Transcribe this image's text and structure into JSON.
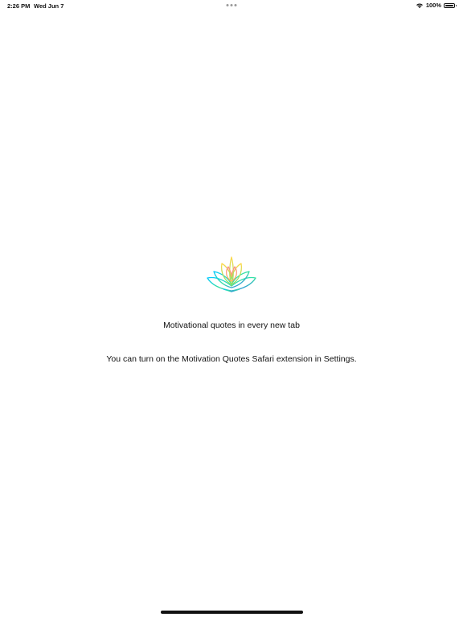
{
  "status_bar": {
    "time": "2:26 PM",
    "date": "Wed Jun 7",
    "battery_percent": "100%",
    "battery_level": 1.0,
    "icons": [
      "wifi-icon",
      "battery-icon"
    ]
  },
  "main": {
    "logo_icon": "lotus-logo-icon",
    "tagline": "Motivational quotes in every new tab",
    "instructions": "You can turn on the Motivation Quotes Safari extension in Settings."
  },
  "colors": {
    "background": "#ffffff",
    "text": "#111111",
    "logo_gradient": [
      "#ff6b6b",
      "#ffd93d",
      "#6bcB77",
      "#00c2ff",
      "#4d7cff"
    ]
  }
}
